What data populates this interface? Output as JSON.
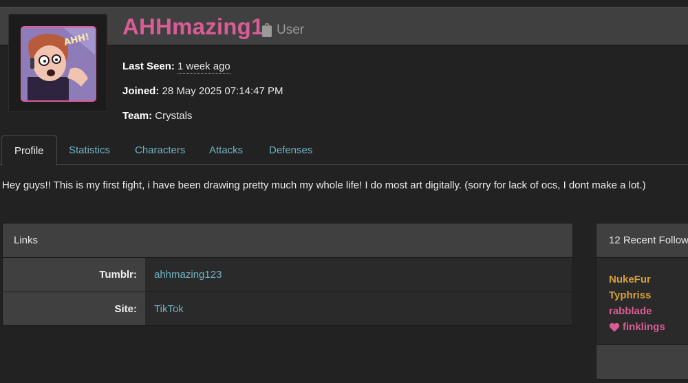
{
  "profile": {
    "username": "AHHmazing1",
    "role": "User",
    "last_seen_label": "Last Seen:",
    "last_seen_value": "1 week ago",
    "joined_label": "Joined:",
    "joined_value": "28 May 2025 07:14:47 PM",
    "team_label": "Team:",
    "team_value": "Crystals",
    "avatar_text": "AHH!",
    "accent_color": "#d85c95"
  },
  "tabs": [
    {
      "label": "Profile",
      "active": true
    },
    {
      "label": "Statistics",
      "active": false
    },
    {
      "label": "Characters",
      "active": false
    },
    {
      "label": "Attacks",
      "active": false
    },
    {
      "label": "Defenses",
      "active": false
    }
  ],
  "bio": "Hey guys!! This is my first fight, i have been drawing pretty much my whole life! I do most art digitally. (sorry for lack of ocs, I dont make a lot.)",
  "links": {
    "title": "Links",
    "rows": [
      {
        "label": "Tumblr:",
        "value": "ahhmazing123"
      },
      {
        "label": "Site:",
        "value": "TikTok"
      }
    ]
  },
  "followers": {
    "title": "12 Recent Follow",
    "items": [
      {
        "name": "NukeFur",
        "color": "#d4a13a",
        "icon": ""
      },
      {
        "name": "Typhriss",
        "color": "#d4a13a",
        "icon": ""
      },
      {
        "name": "rabblade",
        "color": "#d85c95",
        "icon": ""
      },
      {
        "name": "finklings",
        "color": "#d85c95",
        "icon": "heart-icon"
      }
    ]
  }
}
